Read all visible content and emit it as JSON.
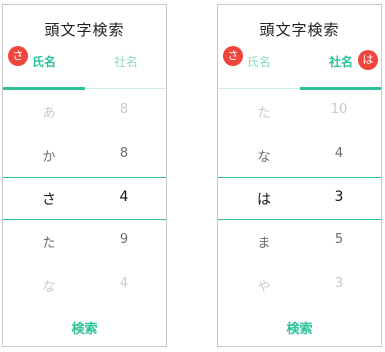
{
  "screens": [
    {
      "title": "頭文字検索",
      "tabs": {
        "left": "氏名",
        "right": "社名"
      },
      "active_tab": "left",
      "badges": [
        "さ"
      ],
      "kana": [
        "あ",
        "か",
        "さ",
        "た",
        "な"
      ],
      "numbers": [
        "8",
        "8",
        "4",
        "9",
        "4"
      ],
      "search_label": "検索"
    },
    {
      "title": "頭文字検索",
      "tabs": {
        "left": "氏名",
        "right": "社名"
      },
      "active_tab": "right",
      "badges": [
        "さ",
        "は"
      ],
      "kana": [
        "た",
        "な",
        "は",
        "ま",
        "や"
      ],
      "numbers": [
        "10",
        "4",
        "3",
        "5",
        "3"
      ],
      "search_label": "検索"
    }
  ],
  "colors": {
    "accent": "#2cc39a",
    "badge": "#f0443c"
  }
}
